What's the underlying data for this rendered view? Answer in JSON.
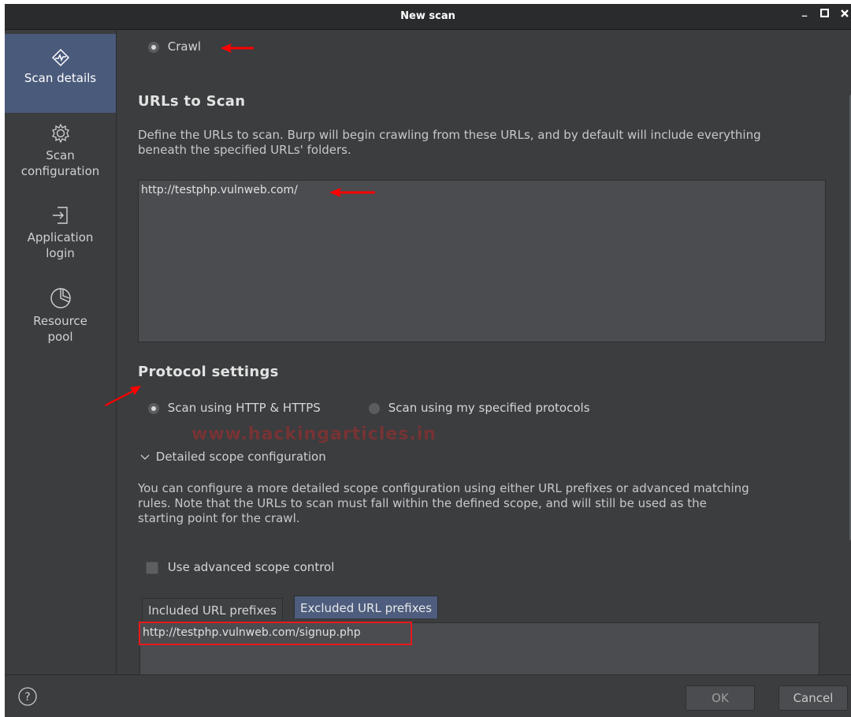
{
  "window": {
    "title": "New scan"
  },
  "sidebar": {
    "items": [
      {
        "label": "Scan details",
        "icon": "scan-details-icon",
        "active": true
      },
      {
        "label": "Scan configuration",
        "line1": "Scan",
        "line2": "configuration",
        "icon": "gear-icon"
      },
      {
        "label": "Application login",
        "line1": "Application",
        "line2": "login",
        "icon": "login-icon"
      },
      {
        "label": "Resource pool",
        "line1": "Resource",
        "line2": "pool",
        "icon": "pie-chart-icon"
      }
    ]
  },
  "scan_type": {
    "crawl_label": "Crawl",
    "selected": "crawl"
  },
  "urls": {
    "heading": "URLs to Scan",
    "description_line1": "Define the URLs to scan. Burp will begin crawling from these URLs, and by default will include everything",
    "description_line2": "beneath the specified URLs' folders.",
    "value": "http://testphp.vulnweb.com/"
  },
  "protocol": {
    "heading": "Protocol settings",
    "option_http": "Scan using HTTP & HTTPS",
    "option_specified": "Scan using my specified protocols",
    "selected": "http"
  },
  "scope": {
    "toggle_label": "Detailed scope configuration",
    "description_line1": "You can configure a more detailed scope configuration using either URL prefixes or advanced matching",
    "description_line2": "rules. Note that the URLs to scan must fall within the defined scope, and will still be used as the",
    "description_line3": "starting point for the crawl.",
    "advanced_label": "Use advanced scope control",
    "advanced_checked": false,
    "tabs": [
      "Included URL prefixes",
      "Excluded URL prefixes"
    ],
    "active_tab": "Excluded URL prefixes",
    "excluded_value": "http://testphp.vulnweb.com/signup.php"
  },
  "watermark": "www.hackingarticles.in",
  "footer": {
    "ok_label": "OK",
    "cancel_label": "Cancel",
    "help_icon": "help-icon"
  },
  "colors": {
    "accent": "#4a5a7b",
    "annotation_red": "#ff0000"
  }
}
